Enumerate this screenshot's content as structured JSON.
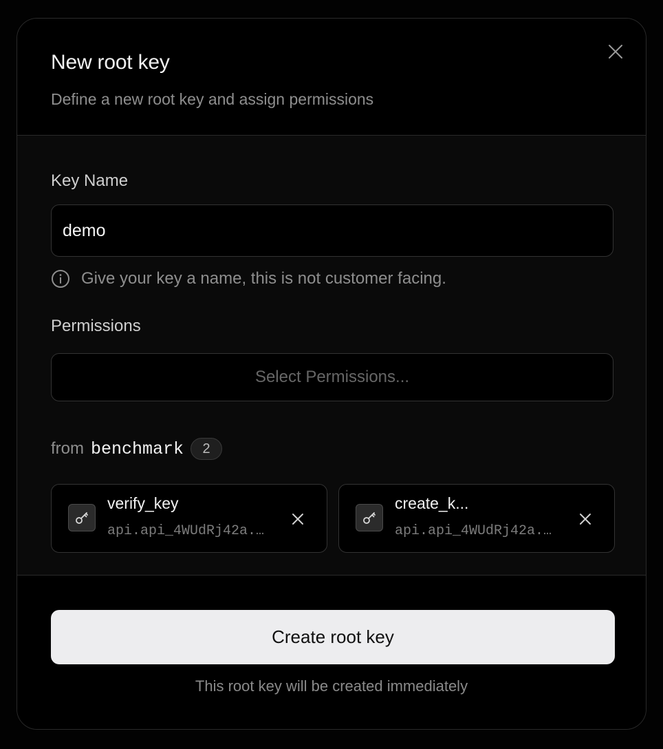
{
  "dialog": {
    "title": "New root key",
    "subtitle": "Define a new root key and assign permissions",
    "close_icon": "close-icon"
  },
  "key_name": {
    "label": "Key Name",
    "value": "demo",
    "hint": "Give your key a name, this is not customer facing.",
    "hint_icon": "info-icon"
  },
  "permissions": {
    "label": "Permissions",
    "placeholder": "Select Permissions...",
    "from_label": "from",
    "api_name": "benchmark",
    "count": "2",
    "selected": [
      {
        "name": "verify_key",
        "path": "api.api_4WUdRj42a...",
        "icon": "key-icon"
      },
      {
        "name": "create_k...",
        "path": "api.api_4WUdRj42a...",
        "icon": "key-icon"
      }
    ]
  },
  "footer": {
    "submit_label": "Create root key",
    "note": "This root key will be created immediately"
  },
  "colors": {
    "background": "#000000",
    "body_background": "#0a0a0a",
    "border": "#2a2a2a",
    "button_background": "#ededef",
    "muted_text": "#8e8e8e"
  }
}
